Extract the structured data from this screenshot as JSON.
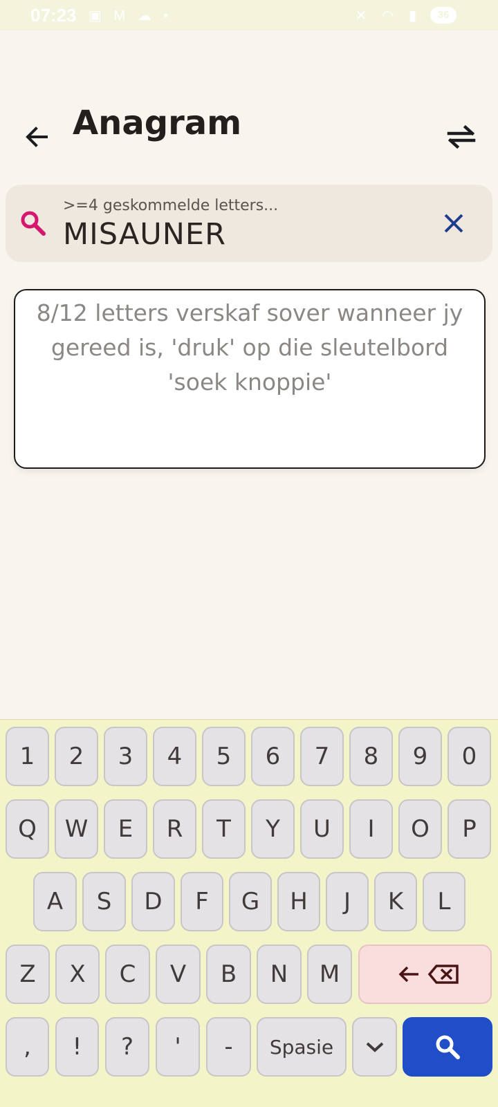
{
  "status_bar": {
    "time": "07:23",
    "battery": "36"
  },
  "header": {
    "title": "Anagram"
  },
  "search": {
    "placeholder": ">=4 geskommelde letters...",
    "value": "MISAUNER"
  },
  "info": {
    "message": "8/12 letters verskaf sover wanneer jy gereed is, 'druk' op die sleutelbord 'soek knoppie'"
  },
  "keyboard": {
    "row1": [
      "1",
      "2",
      "3",
      "4",
      "5",
      "6",
      "7",
      "8",
      "9",
      "0"
    ],
    "row2": [
      "Q",
      "W",
      "E",
      "R",
      "T",
      "Y",
      "U",
      "I",
      "O",
      "P"
    ],
    "row3": [
      "A",
      "S",
      "D",
      "F",
      "G",
      "H",
      "J",
      "K",
      "L"
    ],
    "row4": [
      "Z",
      "X",
      "C",
      "V",
      "B",
      "N",
      "M"
    ],
    "row5": [
      ",",
      "!",
      "?",
      "'",
      "-"
    ],
    "space_label": "Spasie"
  },
  "colors": {
    "search_icon": "#d6156f",
    "clear_icon": "#1f3d8c",
    "go_button": "#1f4ec8",
    "backspace_key": "#fadddd",
    "keyboard_bg": "#f4f4c9"
  }
}
